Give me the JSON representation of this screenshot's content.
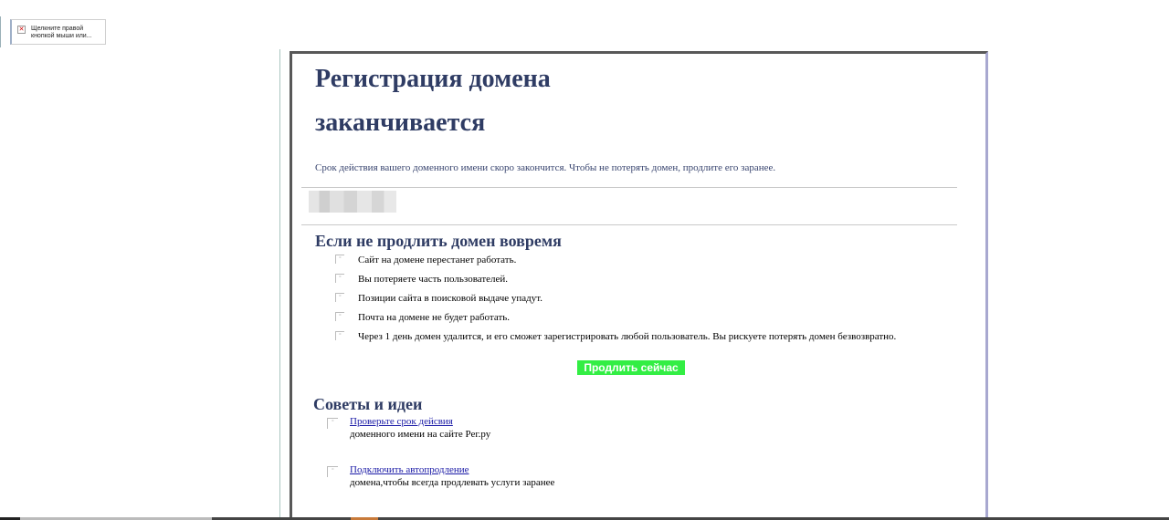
{
  "blocked_image": {
    "text": "Щелкните правой кнопкой мыши или..."
  },
  "email": {
    "title": "Регистрация домена заканчивается",
    "intro": "Срок действия вашего доменного имени скоро закончится. Чтобы не потерять домен, продлите его заранее.",
    "section1_title": "Если не продлить домен вовремя",
    "consequences": [
      "Сайт на домене перестанет работать.",
      "Вы потеряете часть пользователей.",
      "Позиции сайта в поисковой выдаче упадут.",
      "Почта на домене не будет работать.",
      "Через 1 день домен удалится, и его сможет зарегистрировать любой пользователь. Вы рискуете потерять домен безвозвратно."
    ],
    "cta_label": "Продлить сейчас",
    "section2_title": "Советы и идеи",
    "tips": [
      {
        "link": "Проверьте срок дейсвия",
        "desc": "доменного имени на сайте Рег.ру"
      },
      {
        "link": "Подключить автопродление",
        "desc": "домена,чтобы всегда продлевать услуги заранее"
      }
    ]
  },
  "colors": {
    "heading": "#2f3c64",
    "cta_bg": "#33ee44",
    "link": "#1a1aa6"
  },
  "icons": {
    "broken_image": "broken-image-icon",
    "bullet": "image-placeholder-icon"
  }
}
